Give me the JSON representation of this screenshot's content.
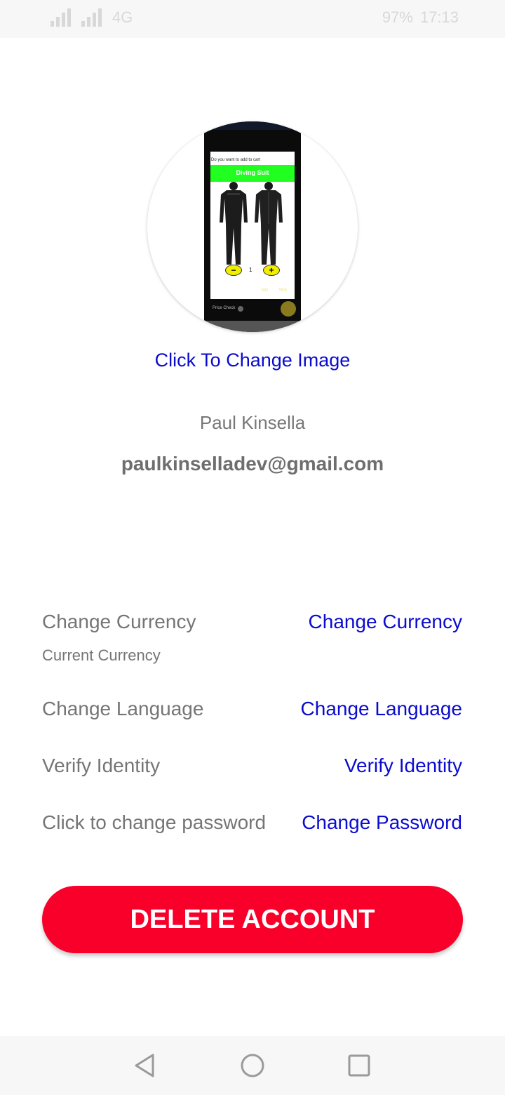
{
  "status_bar": {
    "network_type": "4G",
    "battery": "97%",
    "time": "17:13"
  },
  "profile": {
    "image_preview": {
      "prompt": "Do you want to add to cart",
      "product": "Diving Suit",
      "quantity": "1",
      "no_label": "NO",
      "yes_label": "YES",
      "price_check": "Price Check"
    },
    "change_image_label": "Click To Change Image",
    "name": "Paul Kinsella",
    "email": "paulkinselladev@gmail.com"
  },
  "settings": {
    "currency": {
      "label": "Change Currency",
      "sublabel": "Current Currency",
      "action": "Change Currency"
    },
    "language": {
      "label": "Change Language",
      "action": "Change Language"
    },
    "identity": {
      "label": "Verify Identity",
      "action": "Verify Identity"
    },
    "password": {
      "label": "Click to change password",
      "action": "Change Password"
    }
  },
  "delete_account_label": "DELETE ACCOUNT",
  "navigation": {
    "back_icon": "triangle-back-icon",
    "home_icon": "circle-home-icon",
    "recents_icon": "square-recents-icon"
  },
  "colors": {
    "link": "#0b0bcf",
    "delete": "#f8002a",
    "text_gray": "#757575",
    "preview_green": "#20ff20"
  }
}
